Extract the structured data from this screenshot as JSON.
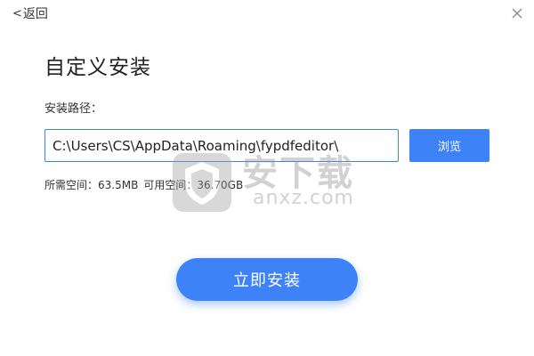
{
  "header": {
    "back_label": "返回",
    "back_glyph": "<"
  },
  "page": {
    "title": "自定义安装",
    "path_label": "安装路径："
  },
  "path_input": {
    "value": "C:\\Users\\CS\\AppData\\Roaming\\fypdfeditor\\"
  },
  "browse_label": "浏览",
  "space_info": {
    "required": "所需空间：63.5MB",
    "available": "可用空间：36.70GB"
  },
  "install_label": "立即安装",
  "watermark": {
    "cn": "安下载",
    "en": "anxz.com"
  },
  "colors": {
    "accent": "#3e82f7"
  }
}
